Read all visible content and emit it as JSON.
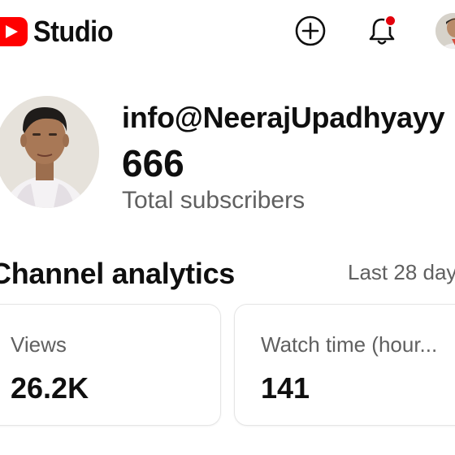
{
  "header": {
    "logo_text": "Studio",
    "logo_icon": "youtube-play-icon",
    "create_icon": "add-circle-icon",
    "notifications_icon": "bell-icon",
    "has_notification": true,
    "brand_color": "#ff0000"
  },
  "channel": {
    "name": "info@NeerajUpadhyayy",
    "subscriber_count": "666",
    "subscriber_label": "Total subscribers"
  },
  "analytics": {
    "title": "Channel analytics",
    "period": "Last 28 day",
    "cards": [
      {
        "label": "Views",
        "value": "26.2K"
      },
      {
        "label": "Watch time (hour...",
        "value": "141"
      }
    ]
  }
}
